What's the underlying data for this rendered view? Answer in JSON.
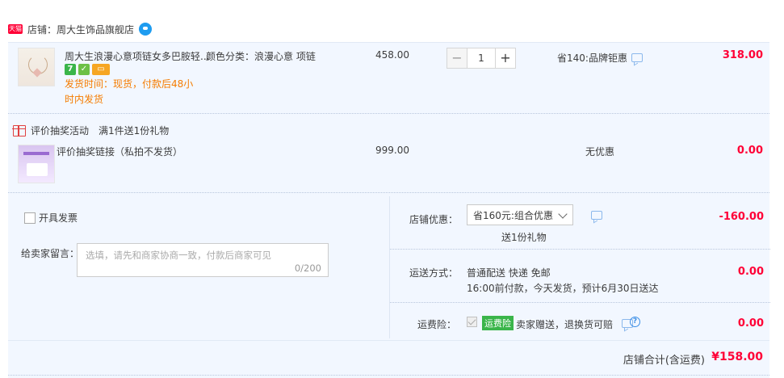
{
  "shop": {
    "badge": "天猫",
    "label": "店铺：周大生饰品旗舰店"
  },
  "item1": {
    "title": "周大生浪漫心意项链女多巴胺轻...",
    "sku": "颜色分类：浪漫心意 项链",
    "service_icons": [
      "seven-day-return-icon",
      "guarantee-icon",
      "card-icon"
    ],
    "ship_time": "发货时间：现货，付款后48小时内发货",
    "price": "458.00",
    "qty_minus": "−",
    "qty_value": "1",
    "qty_plus": "+",
    "discount": "省140:品牌钜惠",
    "subtotal": "318.00"
  },
  "gift": {
    "title": "评价抽奖活动",
    "desc": "满1件送1份礼物"
  },
  "item2": {
    "title": "评价抽奖链接（私拍不发货）",
    "price": "999.00",
    "discount": "无优惠",
    "subtotal": "0.00"
  },
  "invoice": {
    "label": "开具发票"
  },
  "message": {
    "label": "给卖家留言：",
    "placeholder": "选填，请先和商家协商一致，付款后商家可见",
    "count": "0/200"
  },
  "shop_discount": {
    "label": "店铺优惠：",
    "selected": "省160元:组合优惠",
    "gift_note": "送1份礼物",
    "amount": "-160.00"
  },
  "shipping": {
    "label": "运送方式：",
    "line1": "普通配送 快递 免邮",
    "line2": "16:00前付款，今天发货，预计6月30日送达",
    "amount": "0.00"
  },
  "insurance": {
    "label": "运费险：",
    "badge": "运费险",
    "text": "卖家赠送，退换货可赔",
    "help": "?",
    "amount": "0.00"
  },
  "total": {
    "label": "店铺合计(含运费)",
    "amount": "¥158.00"
  },
  "colors": {
    "accent": "#ff0036",
    "panel_bg": "#f2f7ff",
    "orange_text": "#f57c00"
  }
}
